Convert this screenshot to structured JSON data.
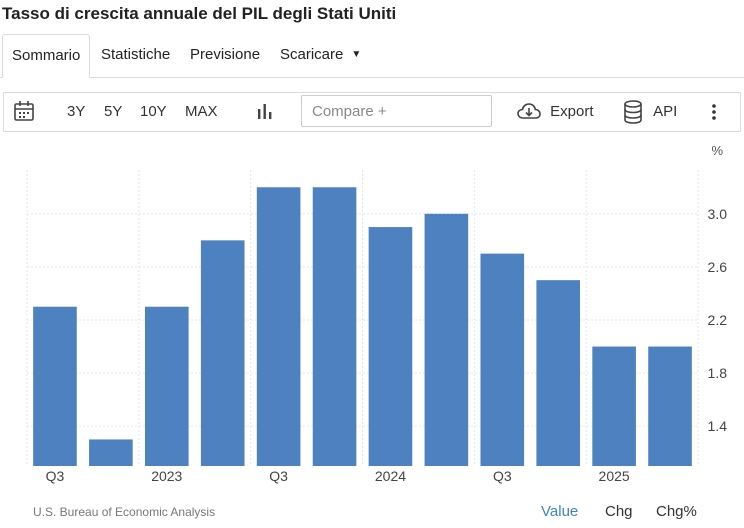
{
  "title": "Tasso di crescita annuale del PIL degli Stati Uniti",
  "tabs": [
    {
      "label": "Sommario",
      "active": true
    },
    {
      "label": "Statistiche"
    },
    {
      "label": "Previsione"
    },
    {
      "label": "Scaricare"
    }
  ],
  "toolbar": {
    "ranges": [
      "3Y",
      "5Y",
      "10Y",
      "MAX"
    ],
    "compare_placeholder": "Compare +",
    "export_label": "Export",
    "api_label": "API"
  },
  "colors": {
    "bar": "#4d81c0",
    "grid": "#e6e6e6",
    "link": "#3d85c6"
  },
  "chart_data": {
    "type": "bar",
    "unit_label": "%",
    "categories": [
      "2022 Q3",
      "2022 Q4",
      "2023 Q1",
      "2023 Q2",
      "2023 Q3",
      "2023 Q4",
      "2024 Q1",
      "2024 Q2",
      "2024 Q3",
      "2024 Q4",
      "2025 Q1",
      "2025 Q2"
    ],
    "values": [
      2.3,
      1.3,
      2.3,
      2.8,
      3.2,
      3.2,
      2.9,
      3.0,
      2.7,
      2.5,
      2.0,
      2.0
    ],
    "x_tick_labels": [
      "Q3",
      "",
      "2023",
      "",
      "Q3",
      "",
      "2024",
      "",
      "Q3",
      "",
      "2025",
      ""
    ],
    "y_ticks": [
      1.4,
      1.8,
      2.2,
      2.6,
      3.0
    ],
    "ylim": [
      1.1,
      3.33
    ],
    "grid": true
  },
  "footer": {
    "source": "U.S. Bureau of Economic Analysis",
    "value_label": "Value",
    "chg_label": "Chg",
    "chgpct_label": "Chg%"
  }
}
